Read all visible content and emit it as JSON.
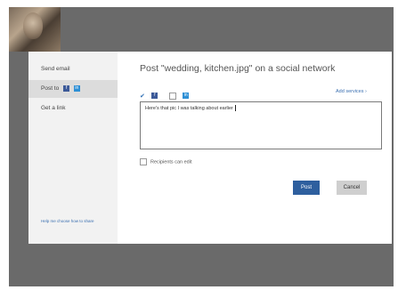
{
  "sidebar": {
    "items": [
      {
        "label": "Send email"
      },
      {
        "label": "Post to"
      },
      {
        "label": "Get a link"
      }
    ],
    "help_link": "Help me choose how to share"
  },
  "main": {
    "title": "Post \"wedding, kitchen.jpg\" on a social network",
    "add_services": "Add services",
    "message": "Here's that pic I was talking about earlier",
    "recipients_label": "Recipients can edit"
  },
  "buttons": {
    "post": "Post",
    "cancel": "Cancel"
  },
  "icons": {
    "facebook": "facebook-icon",
    "linkedin": "linkedin-icon"
  },
  "colors": {
    "accent": "#2e5f9e",
    "link": "#3a6fb0",
    "backdrop": "#6a6a6a"
  }
}
